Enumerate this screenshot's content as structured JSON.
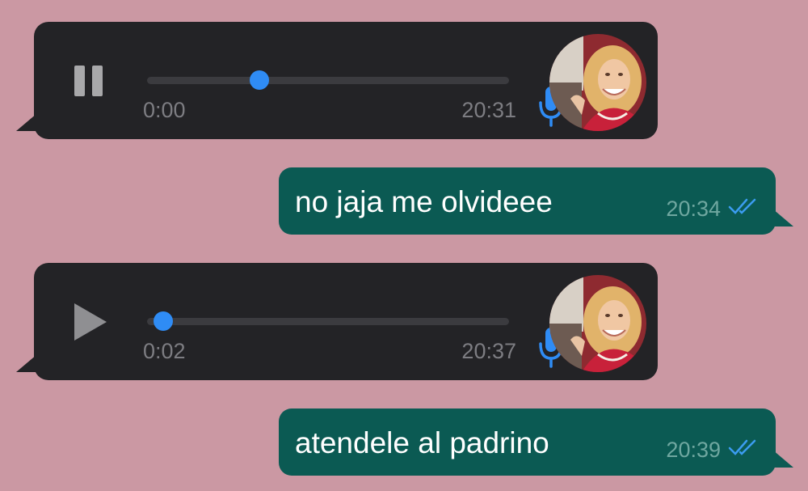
{
  "messages": [
    {
      "type": "voice",
      "direction": "incoming",
      "state": "playing",
      "control_icon": "pause-icon",
      "elapsed": "0:00",
      "time": "20:31",
      "progress": 0.3,
      "mic_color": "#2f8cf5"
    },
    {
      "type": "text",
      "direction": "outgoing",
      "text": "no jaja me olvideee",
      "time": "20:34",
      "status_icon": "double-check-icon",
      "status_color": "#3b9cf0"
    },
    {
      "type": "voice",
      "direction": "incoming",
      "state": "paused",
      "control_icon": "play-icon",
      "elapsed": "0:02",
      "time": "20:37",
      "progress": 0.02,
      "mic_color": "#2f8cf5"
    },
    {
      "type": "text",
      "direction": "outgoing",
      "text": "atendele al padrino",
      "time": "20:39",
      "status_icon": "double-check-icon",
      "status_color": "#3b9cf0"
    }
  ],
  "colors": {
    "background": "#cb98a3",
    "incoming_bubble": "#232326",
    "outgoing_bubble": "#0b5a53",
    "accent": "#2f8cf5"
  }
}
